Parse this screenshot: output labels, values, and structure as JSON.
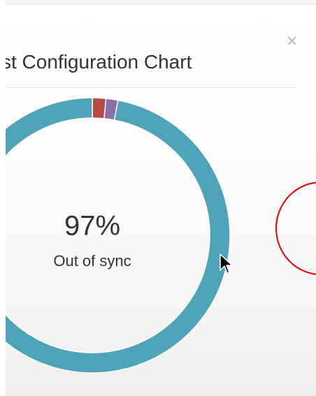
{
  "modal": {
    "title": "st Configuration Chart",
    "close_symbol": "×"
  },
  "chart_data": {
    "type": "pie",
    "donut": true,
    "center_value": "97%",
    "center_label": "Out of sync",
    "slices": [
      {
        "label": "",
        "value": 97,
        "color": "#4fa3b8"
      },
      {
        "label": "",
        "value": 1.6,
        "color": "#b84a45"
      },
      {
        "label": "",
        "value": 1.4,
        "color": "#8b6fad"
      }
    ]
  },
  "icons": {
    "close": "close-icon",
    "cursor": "mouse-pointer-icon"
  }
}
